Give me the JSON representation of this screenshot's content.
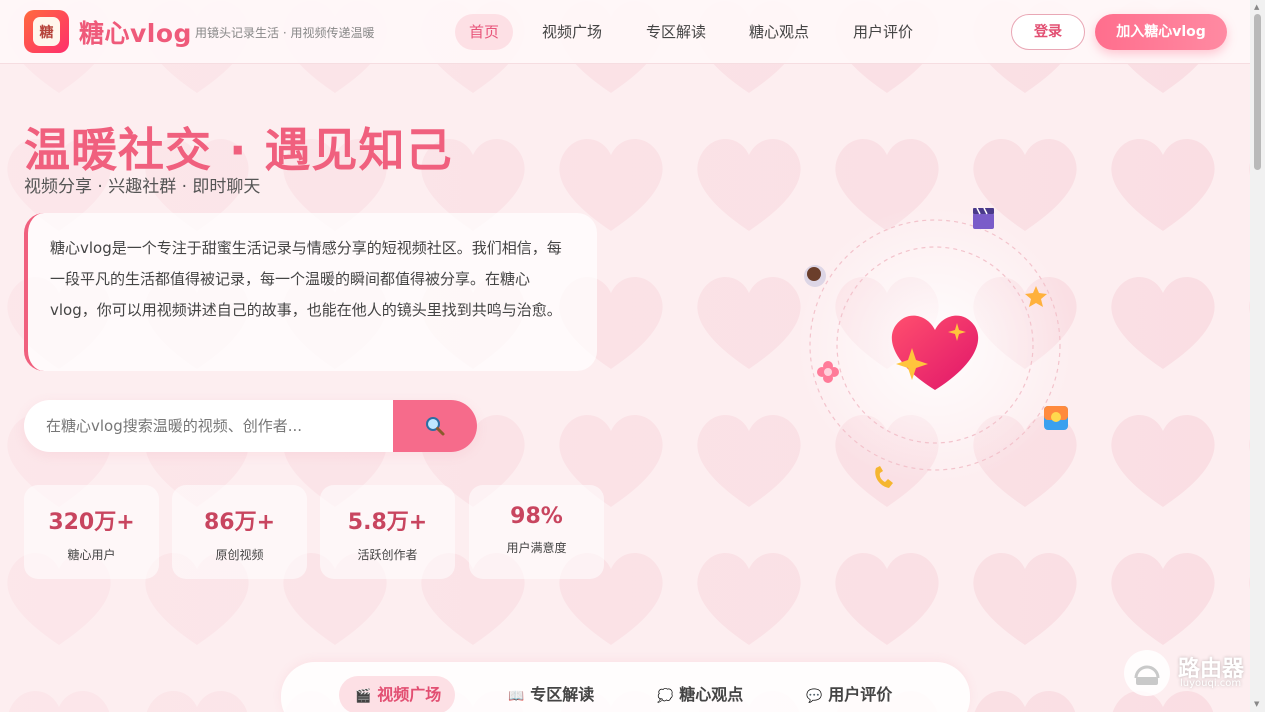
{
  "brand": {
    "logo_char": "糖",
    "name": "糖心vlog",
    "slogan": "用镜头记录生活 · 用视频传递温暖"
  },
  "nav": {
    "items": [
      {
        "label": "首页",
        "active": true
      },
      {
        "label": "视频广场",
        "active": false
      },
      {
        "label": "专区解读",
        "active": false
      },
      {
        "label": "糖心观点",
        "active": false
      },
      {
        "label": "用户评价",
        "active": false
      }
    ],
    "login_label": "登录",
    "join_label": "加入糖心vlog"
  },
  "hero": {
    "title": "温暖社交 · 遇见知己",
    "subtitle": "视频分享 · 兴趣社群 · 即时聊天",
    "intro": "糖心vlog是一个专注于甜蜜生活记录与情感分享的短视频社区。我们相信，每一段平凡的生活都值得被记录，每一个温暖的瞬间都值得被分享。在糖心vlog，你可以用视频讲述自己的故事，也能在他人的镜头里找到共鸣与治愈。"
  },
  "search": {
    "placeholder": "在糖心vlog搜索温暖的视频、创作者..."
  },
  "stats": [
    {
      "value": "320万+",
      "label": "糖心用户"
    },
    {
      "value": "86万+",
      "label": "原创视频"
    },
    {
      "value": "5.8万+",
      "label": "活跃创作者"
    },
    {
      "value": "98%",
      "label": "用户满意度"
    }
  ],
  "illustration_icons": [
    "heart-sparkle-icon",
    "clapperboard-icon",
    "coffee-icon",
    "star-icon",
    "flower-icon",
    "photo-icon",
    "phone-call-icon"
  ],
  "tabs": [
    {
      "icon": "🎬",
      "label": "视频广场",
      "active": true
    },
    {
      "icon": "📖",
      "label": "专区解读",
      "active": false
    },
    {
      "icon": "💭",
      "label": "糖心观点",
      "active": false
    },
    {
      "icon": "💬",
      "label": "用户评价",
      "active": false
    }
  ],
  "watermark": {
    "text": "路由器",
    "sub": "luyouqi.com"
  },
  "colors": {
    "accent": "#f0607e",
    "accent_dark": "#c8455f",
    "background": "#fdeef0"
  }
}
